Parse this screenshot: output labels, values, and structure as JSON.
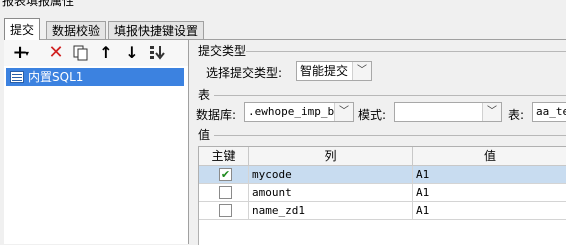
{
  "window": {
    "title": "报表填报属性"
  },
  "tabs": [
    {
      "label": "提交",
      "active": true
    },
    {
      "label": "数据校验",
      "active": false
    },
    {
      "label": "填报快捷键设置",
      "active": false
    }
  ],
  "toolbar": {
    "add_icon": "plus-dropdown-icon",
    "delete_icon": "red-x-icon",
    "copy_icon": "copy-icon",
    "up_icon": "arrow-up-icon",
    "down_icon": "arrow-down-icon",
    "move_icon": "move-down-list-icon"
  },
  "tree": {
    "items": [
      {
        "label": "内置SQL1",
        "selected": true
      }
    ]
  },
  "submit_type": {
    "section_label": "提交类型",
    "select_label": "选择提交类型:",
    "select_value": "智能提交"
  },
  "table_section": {
    "section_label": "表",
    "db_label": "数据库:",
    "db_value": ".ewhope_imp_bd",
    "schema_label": "模式:",
    "schema_value": "",
    "table_label": "表:",
    "table_value": "aa_te"
  },
  "values_section": {
    "section_label": "值",
    "columns": [
      "主键",
      "列",
      "值"
    ],
    "rows": [
      {
        "key": true,
        "column": "mycode",
        "value": "A1",
        "selected": true
      },
      {
        "key": false,
        "column": "amount",
        "value": "A1",
        "selected": false
      },
      {
        "key": false,
        "column": "name_zd1",
        "value": "A1",
        "selected": false
      }
    ]
  },
  "colors": {
    "selection": "#3c82e0",
    "row_selected": "#c8dcf0",
    "delete": "#d02020"
  }
}
